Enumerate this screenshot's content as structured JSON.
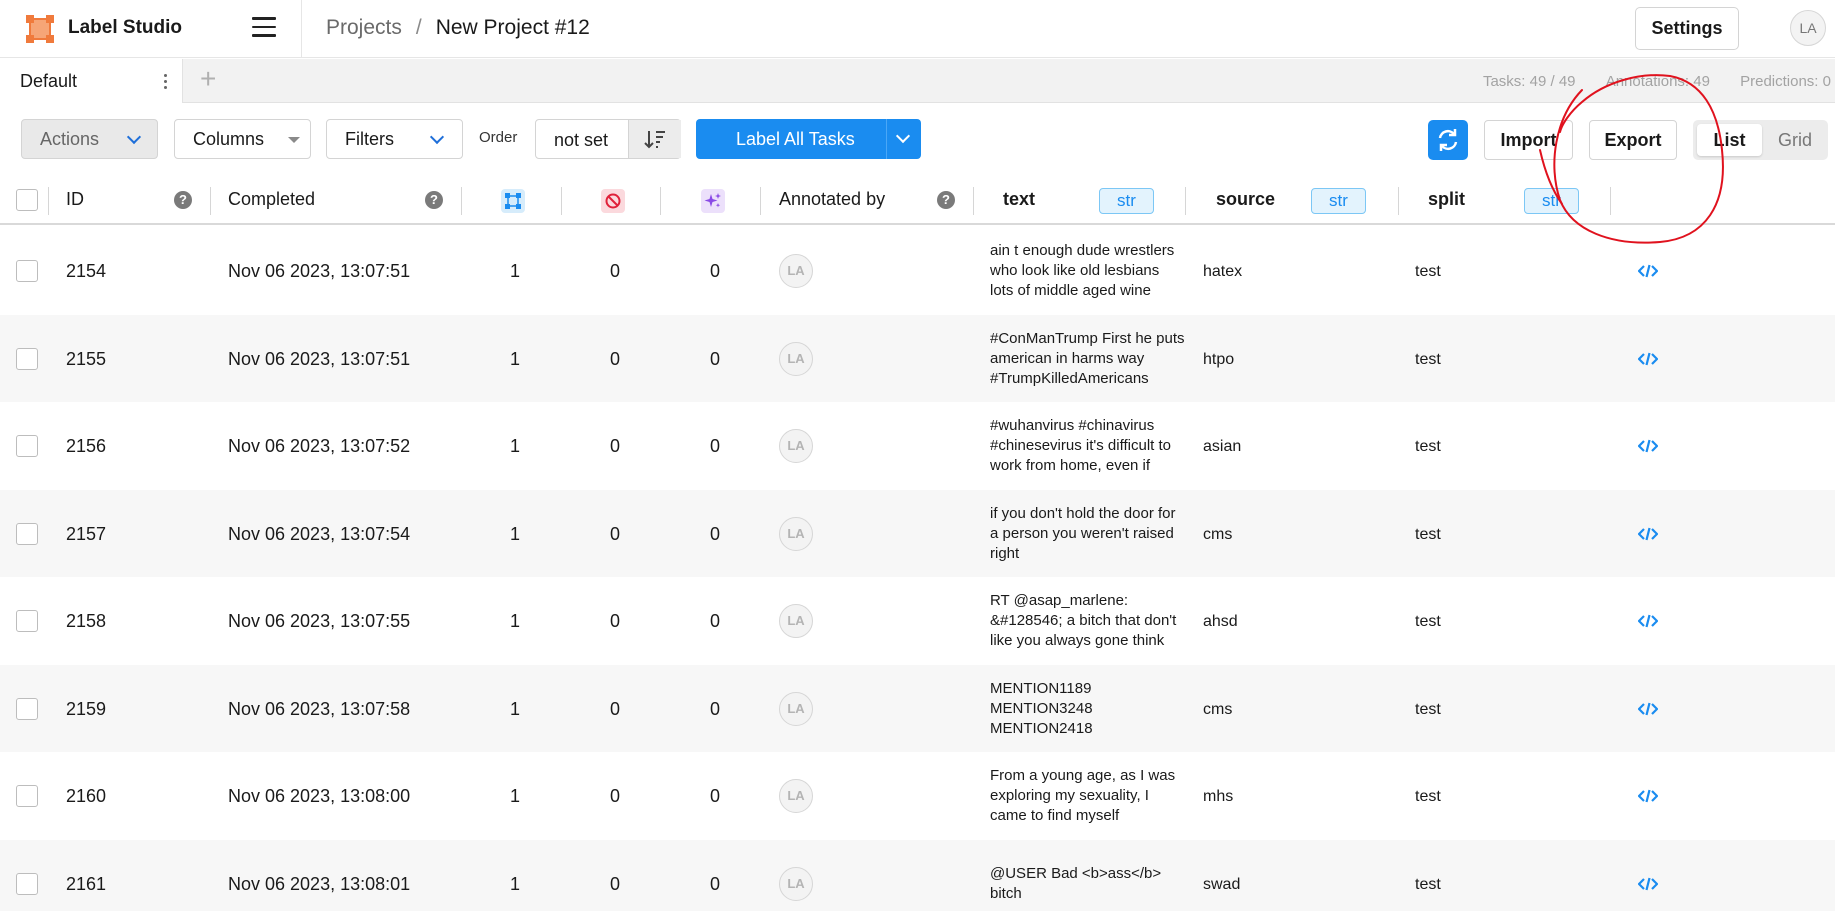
{
  "app": {
    "name": "Label Studio",
    "user_initials": "LA"
  },
  "breadcrumb": {
    "projects": "Projects",
    "separator": "/",
    "current": "New Project #12"
  },
  "header": {
    "settings_label": "Settings"
  },
  "tabs": {
    "default_label": "Default",
    "add_symbol": "+"
  },
  "stats": {
    "tasks": "Tasks: 49 / 49",
    "annotations": "Annotations: 49",
    "predictions": "Predictions: 0"
  },
  "toolbar": {
    "actions_label": "Actions",
    "columns_label": "Columns",
    "filters_label": "Filters",
    "order_label": "Order",
    "order_value": "not set",
    "label_all_label": "Label All Tasks",
    "import_label": "Import",
    "export_label": "Export",
    "view_list": "List",
    "view_grid": "Grid"
  },
  "columns": {
    "id": "ID",
    "completed": "Completed",
    "annotated_by": "Annotated by",
    "text": "text",
    "source": "source",
    "split": "split",
    "type_tag": "str",
    "help_symbol": "?"
  },
  "rows": [
    {
      "id": "2154",
      "completed": "Nov 06 2023, 13:07:51",
      "annotations": "1",
      "cancelled": "0",
      "predictions": "0",
      "annotator": "LA",
      "text": "ain t enough dude wrestlers who look like old lesbians lots of middle aged wine",
      "source": "hatex",
      "split": "test"
    },
    {
      "id": "2155",
      "completed": "Nov 06 2023, 13:07:51",
      "annotations": "1",
      "cancelled": "0",
      "predictions": "0",
      "annotator": "LA",
      "text": "#ConManTrump First he puts american in harms way #TrumpKilledAmericans",
      "source": "htpo",
      "split": "test"
    },
    {
      "id": "2156",
      "completed": "Nov 06 2023, 13:07:52",
      "annotations": "1",
      "cancelled": "0",
      "predictions": "0",
      "annotator": "LA",
      "text": "#wuhanvirus #chinavirus #chinesevirus it's difficult to work from home, even if",
      "source": "asian",
      "split": "test"
    },
    {
      "id": "2157",
      "completed": "Nov 06 2023, 13:07:54",
      "annotations": "1",
      "cancelled": "0",
      "predictions": "0",
      "annotator": "LA",
      "text": "if you don't hold the door for a person you weren't raised right",
      "source": "cms",
      "split": "test"
    },
    {
      "id": "2158",
      "completed": "Nov 06 2023, 13:07:55",
      "annotations": "1",
      "cancelled": "0",
      "predictions": "0",
      "annotator": "LA",
      "text": "RT @asap_marlene: &#128546; a bitch that don't like you always gone think",
      "source": "ahsd",
      "split": "test"
    },
    {
      "id": "2159",
      "completed": "Nov 06 2023, 13:07:58",
      "annotations": "1",
      "cancelled": "0",
      "predictions": "0",
      "annotator": "LA",
      "text": "MENTION1189 MENTION3248 MENTION2418",
      "source": "cms",
      "split": "test"
    },
    {
      "id": "2160",
      "completed": "Nov 06 2023, 13:08:00",
      "annotations": "1",
      "cancelled": "0",
      "predictions": "0",
      "annotator": "LA",
      "text": "From a young age, as I was exploring my sexuality, I came to find myself",
      "source": "mhs",
      "split": "test"
    },
    {
      "id": "2161",
      "completed": "Nov 06 2023, 13:08:01",
      "annotations": "1",
      "cancelled": "0",
      "predictions": "0",
      "annotator": "LA",
      "text": "@USER Bad <b>ass</b> bitch",
      "source": "swad",
      "split": "test"
    }
  ],
  "colors": {
    "accent": "#1a8cf0",
    "logo": "#f07a3c",
    "annotation_circle": "#e0121e"
  }
}
